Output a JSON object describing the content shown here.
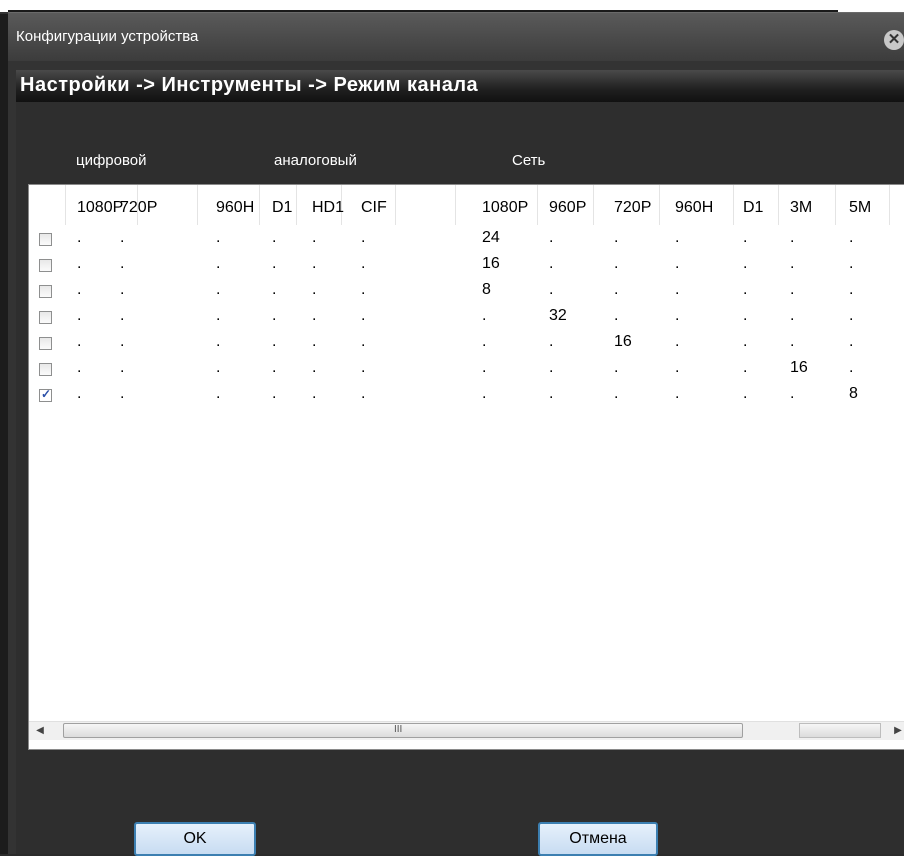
{
  "window": {
    "title": "Конфигурации устройства",
    "breadcrumb": "Настройки -> Инструменты -> Режим канала"
  },
  "groups": {
    "digital": "цифровой",
    "analog": "аналоговый",
    "network": "Сеть"
  },
  "columns": [
    "1080P",
    "720P",
    "960H",
    "D1",
    "HD1",
    "CIF",
    "1080P",
    "960P",
    "720P",
    "960H",
    "D1",
    "3M",
    "5M"
  ],
  "rows": [
    {
      "checked": false,
      "cells": [
        ".",
        ".",
        ".",
        ".",
        ".",
        ".",
        "24",
        ".",
        ".",
        ".",
        ".",
        ".",
        "."
      ]
    },
    {
      "checked": false,
      "cells": [
        ".",
        ".",
        ".",
        ".",
        ".",
        ".",
        "16",
        ".",
        ".",
        ".",
        ".",
        ".",
        "."
      ]
    },
    {
      "checked": false,
      "cells": [
        ".",
        ".",
        ".",
        ".",
        ".",
        ".",
        "8",
        ".",
        ".",
        ".",
        ".",
        ".",
        "."
      ]
    },
    {
      "checked": false,
      "cells": [
        ".",
        ".",
        ".",
        ".",
        ".",
        ".",
        ".",
        "32",
        ".",
        ".",
        ".",
        ".",
        "."
      ]
    },
    {
      "checked": false,
      "cells": [
        ".",
        ".",
        ".",
        ".",
        ".",
        ".",
        ".",
        ".",
        "16",
        ".",
        ".",
        ".",
        "."
      ]
    },
    {
      "checked": false,
      "cells": [
        ".",
        ".",
        ".",
        ".",
        ".",
        ".",
        ".",
        ".",
        ".",
        ".",
        ".",
        "16",
        "."
      ]
    },
    {
      "checked": true,
      "cells": [
        ".",
        ".",
        ".",
        ".",
        ".",
        ".",
        ".",
        ".",
        ".",
        ".",
        ".",
        ".",
        "8"
      ]
    }
  ],
  "scrollbar": {
    "grip": "III"
  },
  "buttons": {
    "ok": "OK",
    "cancel": "Отмена"
  },
  "icons": {
    "close": "close-icon",
    "left": "arrow-left-icon",
    "right": "arrow-right-icon"
  }
}
